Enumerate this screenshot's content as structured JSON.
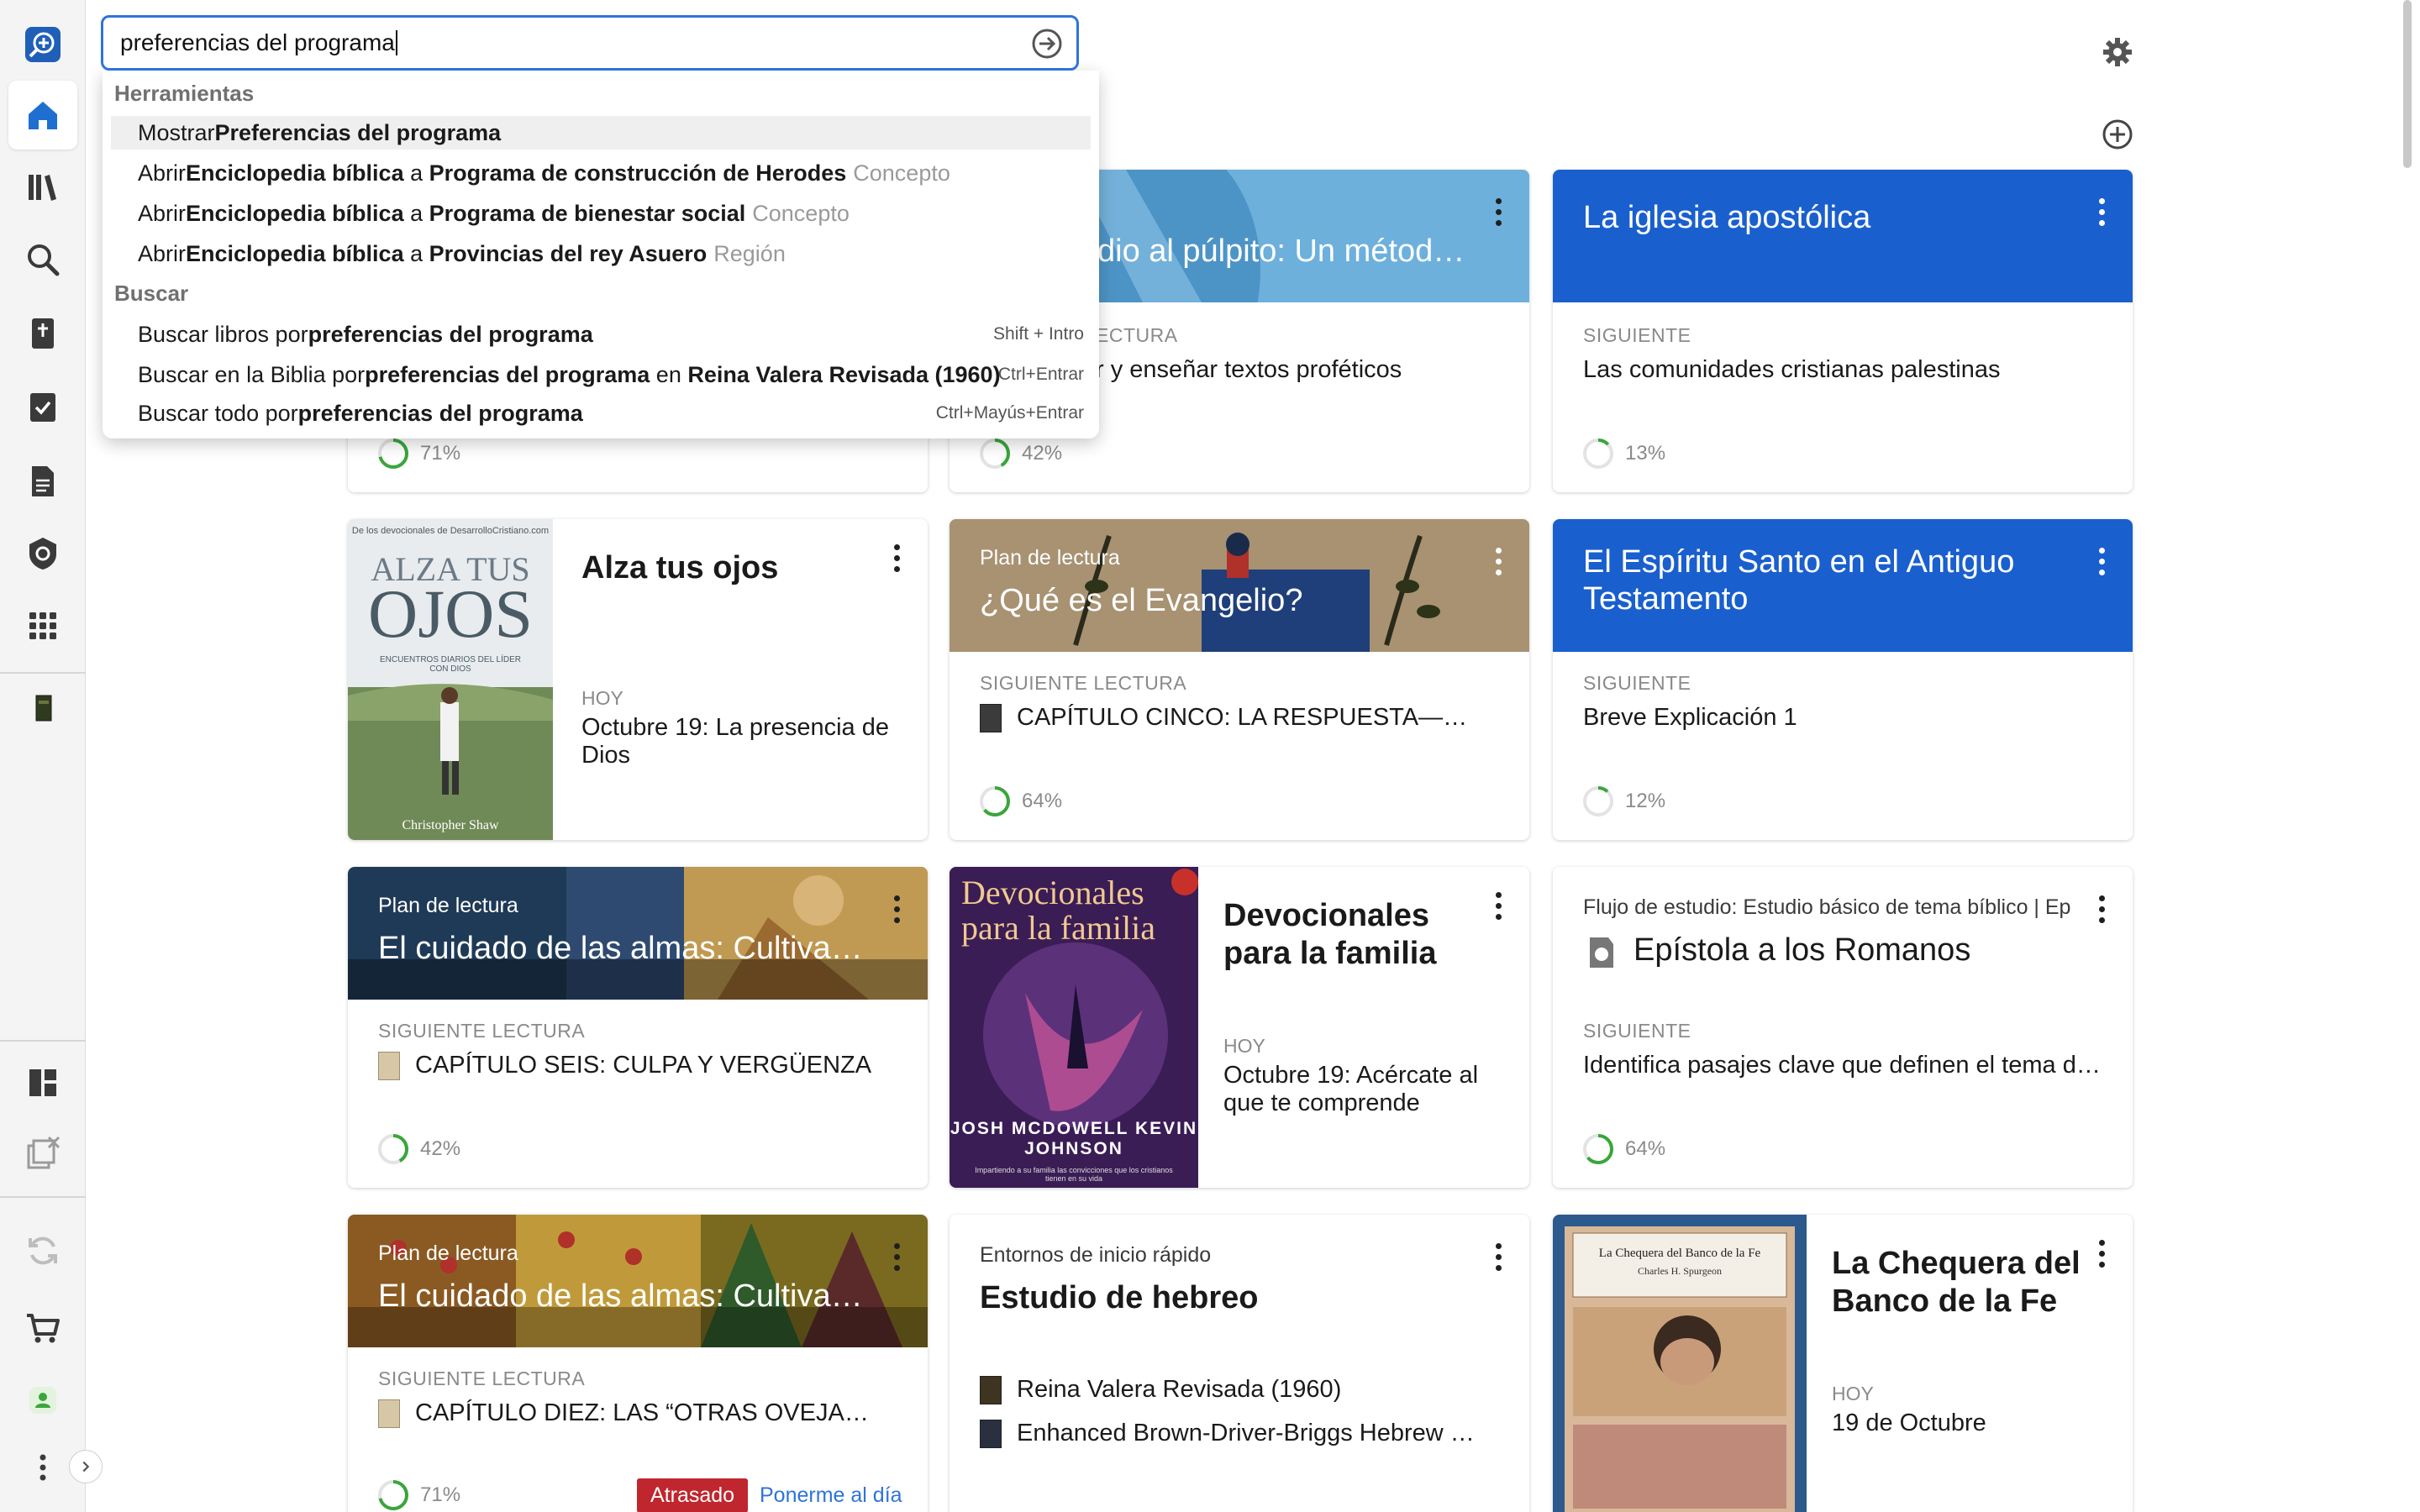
{
  "search": {
    "value": "preferencias del programa"
  },
  "dropdown": {
    "section1": "Herramientas",
    "section2": "Buscar",
    "rows": [
      {
        "pre": "Mostrar ",
        "b1": "Preferencias del programa",
        "mid": "",
        "b2": "",
        "muted": "",
        "shortcut": ""
      },
      {
        "pre": "Abrir ",
        "b1": "Enciclopedia bíblica",
        "mid": " a ",
        "b2": "Programa de construcción de Herodes",
        "muted": "Concepto",
        "shortcut": ""
      },
      {
        "pre": "Abrir ",
        "b1": "Enciclopedia bíblica",
        "mid": " a ",
        "b2": "Programa de bienestar social",
        "muted": "Concepto",
        "shortcut": ""
      },
      {
        "pre": "Abrir ",
        "b1": "Enciclopedia bíblica",
        "mid": " a ",
        "b2": "Provincias del rey Asuero",
        "muted": "Región",
        "shortcut": ""
      },
      {
        "pre": "Buscar libros por ",
        "b1": "preferencias del programa",
        "mid": "",
        "b2": "",
        "muted": "",
        "shortcut": "Shift + Intro"
      },
      {
        "pre": "Buscar en la Biblia por ",
        "b1": "preferencias del programa",
        "mid": " en ",
        "b2": "Reina Valera Revisada (1960)",
        "muted": "",
        "shortcut": "Ctrl+Entrar"
      },
      {
        "pre": "Buscar todo por ",
        "b1": "preferencias del programa",
        "mid": "",
        "b2": "",
        "muted": "",
        "shortcut": "Ctrl+Mayús+Entrar"
      }
    ]
  },
  "cards": {
    "c1": {
      "progress": "71%"
    },
    "c2": {
      "kicker": "a",
      "title": "dio al púlpito: Un método…",
      "label": "ECTURA",
      "value": "r y enseñar textos proféticos",
      "progress": "42%"
    },
    "c3": {
      "title": "La iglesia apostólica",
      "label": "SIGUIENTE",
      "value": "Las comunidades cristianas palestinas",
      "progress": "13%"
    },
    "c4": {
      "title": "Alza tus ojos",
      "label": "HOY",
      "value": "Octubre 19: La presencia de Dios",
      "cover_top": "De los devocionales de DesarrolloCristiano.com",
      "cover_title_1": "ALZA TUS",
      "cover_title_2": "OJOS",
      "cover_sub": "ENCUENTROS DIARIOS DEL LÍDER CON DIOS",
      "cover_author": "Christopher Shaw"
    },
    "c5": {
      "kicker": "Plan de lectura",
      "title": "¿Qué es el Evangelio?",
      "label": "SIGUIENTE LECTURA",
      "value": "CAPÍTULO CINCO: LA RESPUESTA—FE Y …",
      "progress": "64%"
    },
    "c6": {
      "title": "El Espíritu Santo en el Antiguo Testamento",
      "label": "SIGUIENTE",
      "value": "Breve Explicación 1",
      "progress": "12%"
    },
    "c7": {
      "kicker": "Plan de lectura",
      "title": "El cuidado de las almas: Cultivan…",
      "label": "SIGUIENTE LECTURA",
      "value": "CAPÍTULO SEIS: CULPA Y VERGÜENZA",
      "progress": "42%"
    },
    "c8": {
      "title": "Devocionales para la familia",
      "label": "HOY",
      "value": "Octubre 19: Acércate al que te comprende",
      "cover_title": "Devocionales para la familia",
      "cover_authors": "JOSH MCDOWELL KEVIN JOHNSON",
      "cover_sub": "Impartiendo a su familia las convicciones que los cristianos tienen en su vida"
    },
    "c9": {
      "kicker": "Flujo de estudio: Estudio básico de tema bíblico | Epístola",
      "title": "Epístola a los Romanos",
      "label": "SIGUIENTE",
      "value": "Identifica pasajes clave que definen el tema d…",
      "progress": "64%"
    },
    "c10": {
      "kicker": "Plan de lectura",
      "title": "El cuidado de las almas: Cultivan…",
      "label": "SIGUIENTE LECTURA",
      "value": "CAPÍTULO DIEZ: LAS “OTRAS OVEJAS” D…",
      "progress": "71%",
      "overdue": "Atrasado",
      "catchup": "Ponerme al día"
    },
    "c11": {
      "kicker": "Entornos de inicio rápido",
      "title": "Estudio de hebreo",
      "item1": "Reina Valera Revisada (1960)",
      "item2": "Enhanced Brown-Driver-Briggs Hebrew an…"
    },
    "c12": {
      "title": "La Chequera del Banco de la Fe",
      "label": "HOY",
      "value": "19 de Octubre",
      "cover_title": "La Chequera del Banco de la Fe",
      "cover_author": "Charles H. Spurgeon"
    }
  },
  "colors": {
    "accent": "#2f74d8",
    "banner_blue": "#1a5fce",
    "progress_green": "#3aa63a",
    "overdue_red": "#c0262e"
  }
}
